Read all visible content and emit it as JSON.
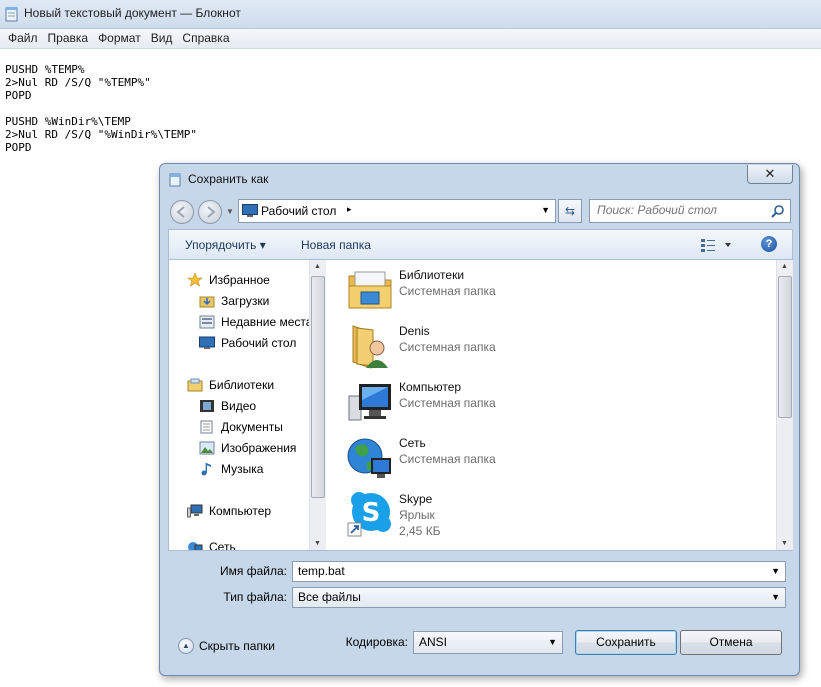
{
  "notepad": {
    "title": "Новый текстовый документ — Блокнот",
    "menu": [
      "Файл",
      "Правка",
      "Формат",
      "Вид",
      "Справка"
    ],
    "text": "PUSHD %TEMP%\n2>Nul RD /S/Q \"%TEMP%\"\nPOPD\n\nPUSHD %WinDir%\\TEMP\n2>Nul RD /S/Q \"%WinDir%\\TEMP\"\nPOPD"
  },
  "dialog": {
    "title": "Сохранить как",
    "close_glyph": "✕",
    "address": {
      "location": "Рабочий стол",
      "separator": "▸"
    },
    "search": {
      "placeholder": "Поиск: Рабочий стол"
    },
    "toolbar": {
      "organize": "Упорядочить ▾",
      "new_folder": "Новая папка",
      "help": "?"
    },
    "nav_pane": {
      "items": [
        {
          "label": "Избранное",
          "icon": "star-icon",
          "level": 0
        },
        {
          "label": "Загрузки",
          "icon": "downloads-folder-icon",
          "level": 1
        },
        {
          "label": "Недавние места",
          "icon": "recent-places-icon",
          "level": 1
        },
        {
          "label": "Рабочий стол",
          "icon": "desktop-icon",
          "level": 1
        },
        {
          "label": "Библиотеки",
          "icon": "libraries-icon",
          "level": 0
        },
        {
          "label": "Видео",
          "icon": "video-icon",
          "level": 1
        },
        {
          "label": "Документы",
          "icon": "documents-icon",
          "level": 1
        },
        {
          "label": "Изображения",
          "icon": "images-icon",
          "level": 1
        },
        {
          "label": "Музыка",
          "icon": "music-icon",
          "level": 1
        },
        {
          "label": "Компьютер",
          "icon": "computer-icon",
          "level": 0
        },
        {
          "label": "Сеть",
          "icon": "network-icon",
          "level": 0
        }
      ]
    },
    "files": [
      {
        "name": "Библиотеки",
        "type": "Системная папка",
        "icon": "libraries-folder-icon"
      },
      {
        "name": "Denis",
        "type": "Системная папка",
        "icon": "user-folder-icon"
      },
      {
        "name": "Компьютер",
        "type": "Системная папка",
        "icon": "computer-icon"
      },
      {
        "name": "Сеть",
        "type": "Системная папка",
        "icon": "network-globe-icon"
      },
      {
        "name": "Skype",
        "type": "Ярлык",
        "size": "2,45 КБ",
        "icon": "skype-icon"
      }
    ],
    "filename": {
      "label": "Имя файла:",
      "value": "temp.bat"
    },
    "filetype": {
      "label": "Тип файла:",
      "value": "Все файлы"
    },
    "hide_folders": "Скрыть папки",
    "encoding": {
      "label": "Кодировка:",
      "value": "ANSI"
    },
    "buttons": {
      "save": "Сохранить",
      "cancel": "Отмена"
    }
  }
}
